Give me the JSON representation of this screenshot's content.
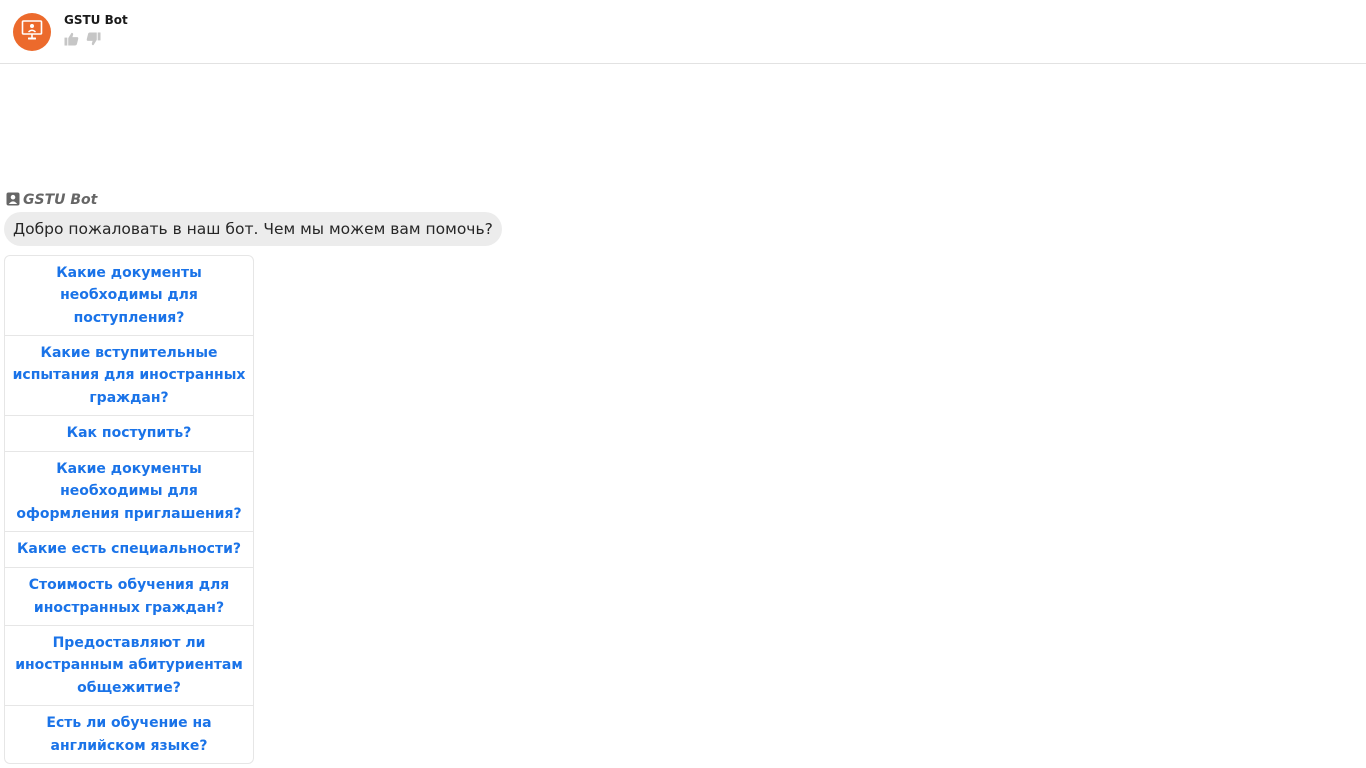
{
  "header": {
    "bot_name": "GSTU Bot",
    "avatar_icon": "presentation-screen-icon",
    "avatar_color": "#ec6a2c",
    "rating": {
      "like_icon": "thumbs-up-icon",
      "dislike_icon": "thumbs-down-icon"
    }
  },
  "chat": {
    "sender": {
      "icon": "user-badge-icon",
      "name": "GSTU Bot"
    },
    "message": "Добро пожаловать в наш бот. Чем мы можем вам помочь?",
    "link_color": "#1a73e8",
    "options": [
      "Какие документы необходимы для поступления?",
      "Какие вступительные испытания для иностранных граждан?",
      "Как поступить?",
      "Какие документы необходимы для оформления приглашения?",
      "Какие есть специальности?",
      "Стоимость обучения для иностранных граждан?",
      "Предоставляют ли иностранным абитуриентам общежитие?",
      "Есть ли обучение на английском языке?"
    ]
  }
}
